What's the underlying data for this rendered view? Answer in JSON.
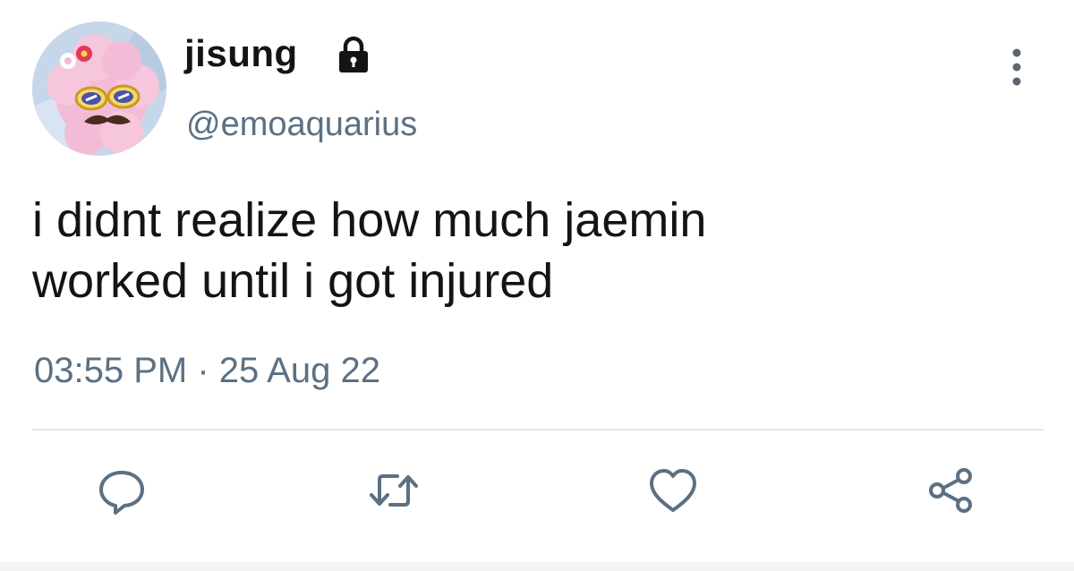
{
  "user": {
    "display_name": "jisung",
    "handle": "@emoaquarius",
    "protected": true
  },
  "tweet": {
    "text_line1": "i didnt realize how much jaemin",
    "text_line2": "worked until i got injured",
    "timestamp": "03:55 PM · 25 Aug 22"
  },
  "actions": [
    {
      "name": "reply",
      "icon": "speech-bubble-icon"
    },
    {
      "name": "retweet",
      "icon": "retweet-arrows-icon"
    },
    {
      "name": "like",
      "icon": "heart-icon"
    },
    {
      "name": "share",
      "icon": "share-nodes-icon"
    }
  ],
  "colors": {
    "text": "#141414",
    "secondary": "#5b7083",
    "divider": "#e4e8ec"
  }
}
